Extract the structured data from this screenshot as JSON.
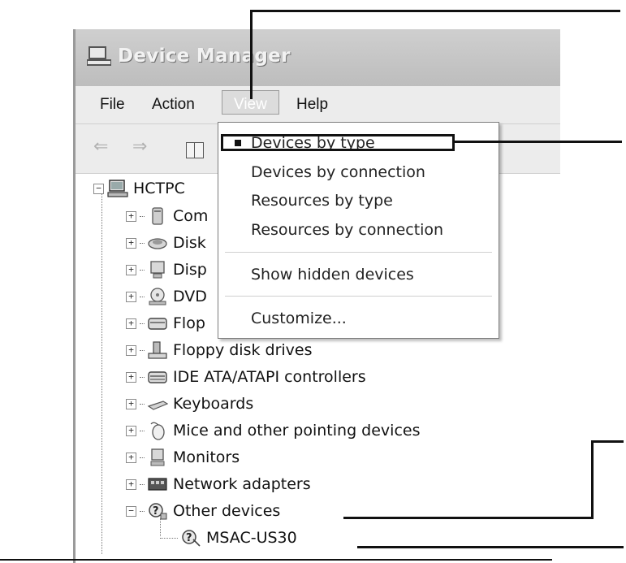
{
  "window": {
    "title": "Device Manager"
  },
  "menubar": {
    "items": [
      "File",
      "Action",
      "View",
      "Help"
    ],
    "open_item": "View"
  },
  "toolbar": {
    "back_label": "⇐",
    "forward_label": "⇒"
  },
  "view_menu": {
    "items": [
      {
        "label": "Devices by type",
        "selected": true
      },
      {
        "label": "Devices by connection",
        "selected": false
      },
      {
        "label": "Resources by type",
        "selected": false
      },
      {
        "label": "Resources by connection",
        "selected": false
      },
      {
        "label": "Show hidden devices",
        "selected": false
      },
      {
        "label": "Customize...",
        "selected": false
      }
    ]
  },
  "tree": {
    "root": {
      "label": "HCTPC",
      "expander": "−"
    },
    "items": [
      {
        "label": "Com",
        "expander": "+",
        "icon": "computer-icon"
      },
      {
        "label": "Disk",
        "expander": "+",
        "icon": "disk-drive-icon"
      },
      {
        "label": "Disp",
        "expander": "+",
        "icon": "display-adapter-icon"
      },
      {
        "label": "DVD",
        "expander": "+",
        "icon": "dvd-drive-icon"
      },
      {
        "label": "Flop",
        "expander": "+",
        "icon": "floppy-controller-icon"
      },
      {
        "label": "Floppy disk drives",
        "expander": "+",
        "icon": "floppy-drive-icon"
      },
      {
        "label": "IDE ATA/ATAPI controllers",
        "expander": "+",
        "icon": "ide-controller-icon"
      },
      {
        "label": "Keyboards",
        "expander": "+",
        "icon": "keyboard-icon"
      },
      {
        "label": "Mice and other pointing devices",
        "expander": "+",
        "icon": "mouse-icon"
      },
      {
        "label": "Monitors",
        "expander": "+",
        "icon": "monitor-icon"
      },
      {
        "label": "Network adapters",
        "expander": "+",
        "icon": "network-adapter-icon"
      },
      {
        "label": "Other devices",
        "expander": "−",
        "icon": "unknown-device-icon"
      }
    ],
    "child": {
      "label": "MSAC-US30",
      "icon": "unknown-device-icon"
    }
  }
}
